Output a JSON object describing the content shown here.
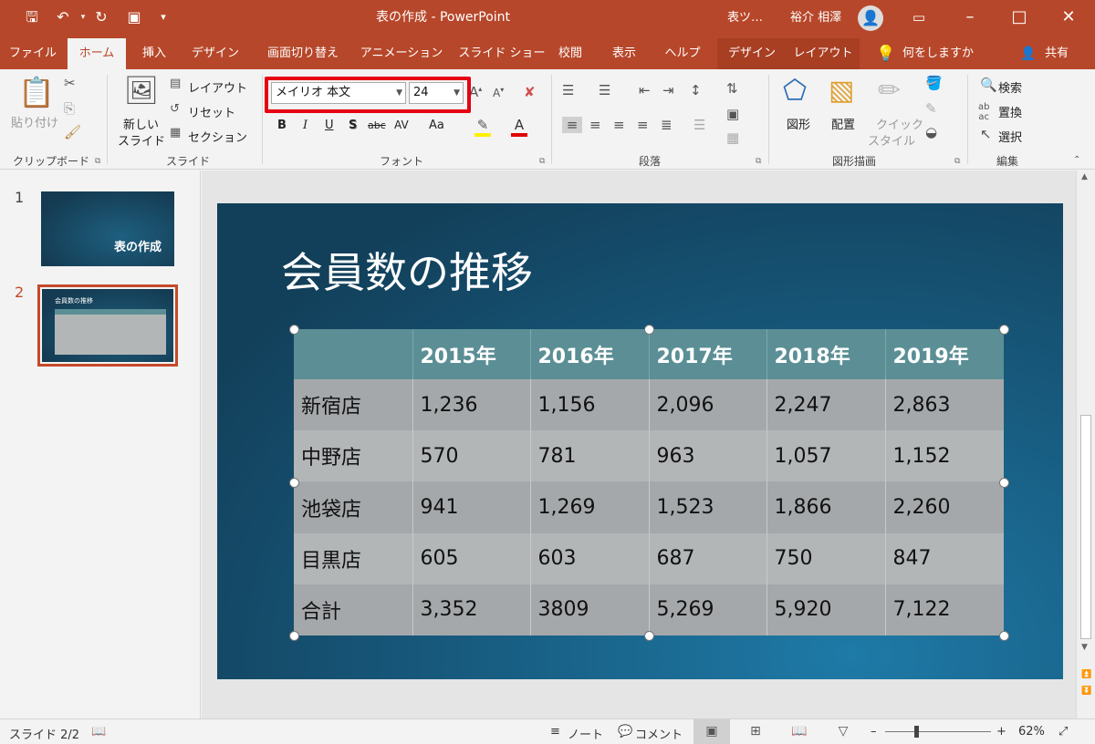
{
  "window": {
    "title": "表の作成 - PowerPoint",
    "context_tab_group": "表ツ…",
    "user_name": "裕介 相澤",
    "accent": "#b7472a"
  },
  "tabs": [
    "ファイル",
    "ホーム",
    "挿入",
    "デザイン",
    "画面切り替え",
    "アニメーション",
    "スライド ショー",
    "校閲",
    "表示",
    "ヘルプ",
    "デザイン",
    "レイアウト"
  ],
  "tell_me": "何をしますか",
  "share": "共有",
  "ribbon": {
    "clipboard": {
      "paste": "貼り付け",
      "label": "クリップボード"
    },
    "slides": {
      "new_slide_1": "新しい",
      "new_slide_2": "スライド",
      "layout": "レイアウト",
      "reset": "リセット",
      "section": "セクション",
      "label": "スライド"
    },
    "font": {
      "name": "メイリオ 本文",
      "size": "24",
      "label": "フォント",
      "bold": "B",
      "italic": "I",
      "underline": "U",
      "shadow": "S",
      "strike": "abc",
      "spacing": "AV",
      "case": "Aa"
    },
    "paragraph": {
      "label": "段落"
    },
    "drawing": {
      "shapes": "図形",
      "arrange": "配置",
      "quick_style_1": "クイック",
      "quick_style_2": "スタイル",
      "label": "図形描画"
    },
    "editing": {
      "find": "検索",
      "replace": "置換",
      "select": "選択",
      "label": "編集"
    }
  },
  "thumbnails": [
    {
      "number": "1",
      "title": "表の作成"
    },
    {
      "number": "2",
      "title": "会員数の推移"
    }
  ],
  "slide": {
    "title": "会員数の推移",
    "table": {
      "headers": [
        "",
        "2015年",
        "2016年",
        "2017年",
        "2018年",
        "2019年"
      ],
      "rows": [
        [
          "新宿店",
          "1,236",
          "1,156",
          "2,096",
          "2,247",
          "2,863"
        ],
        [
          "中野店",
          "570",
          "781",
          "963",
          "1,057",
          "1,152"
        ],
        [
          "池袋店",
          "941",
          "1,269",
          "1,523",
          "1,866",
          "2,260"
        ],
        [
          "目黒店",
          "605",
          "603",
          "687",
          "750",
          "847"
        ],
        [
          "合計",
          "3,352",
          "3809",
          "5,269",
          "5,920",
          "7,122"
        ]
      ]
    }
  },
  "status": {
    "slide_pos": "スライド 2/2",
    "notes": "ノート",
    "comments": "コメント",
    "zoom": "62%"
  }
}
